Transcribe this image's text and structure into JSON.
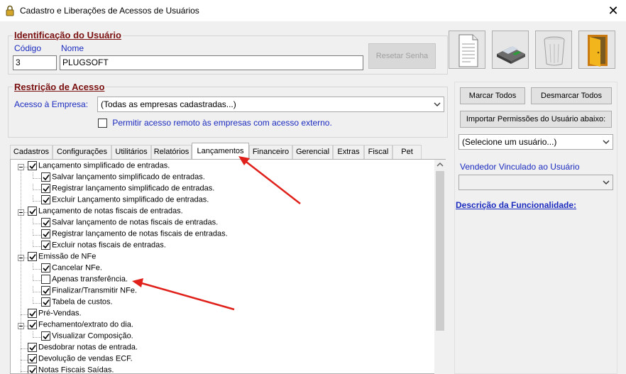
{
  "window": {
    "title": "Cadastro e Liberações de Acessos de Usuários",
    "close_symbol": "✕"
  },
  "identificacao": {
    "section_title": "Identificação do Usuário",
    "codigo_label": "Código",
    "codigo_value": "3",
    "nome_label": "Nome",
    "nome_value": "PLUGSOFT",
    "reset_button": "Resetar Senha"
  },
  "toolbar": {
    "new_icon": "document-icon",
    "save_icon": "floppy-disk-icon",
    "delete_icon": "trash-icon",
    "exit_icon": "exit-door-icon"
  },
  "restricao": {
    "section_title": "Restrição de Acesso",
    "acesso_label": "Acesso à Empresa:",
    "acesso_value": "(Todas as empresas cadastradas...)",
    "remote_checkbox_label": "Permitir acesso remoto às empresas com acesso externo.",
    "remote_checked": false
  },
  "actions": {
    "marcar_todos": "Marcar Todos",
    "desmarcar_todos": "Desmarcar Todos",
    "importar": "Importar Permissões do Usuário abaixo:",
    "user_select_value": "(Selecione um usuário...)"
  },
  "vendedor": {
    "label": "Vendedor Vinculado ao Usuário",
    "value": ""
  },
  "descricao": {
    "label": "Descrição da Funcionalidade:"
  },
  "tabs": [
    {
      "label": "Cadastros",
      "active": false
    },
    {
      "label": "Configurações",
      "active": false
    },
    {
      "label": "Utilitários",
      "active": false
    },
    {
      "label": "Relatórios",
      "active": false
    },
    {
      "label": "Lançamentos",
      "active": true
    },
    {
      "label": "Financeiro",
      "active": false
    },
    {
      "label": "Gerencial",
      "active": false
    },
    {
      "label": "Extras",
      "active": false
    },
    {
      "label": "Fiscal",
      "active": false
    },
    {
      "label": "Pet",
      "active": false
    }
  ],
  "tree": [
    {
      "label": "Lançamento simplificado de entradas.",
      "level": 0,
      "checked": true,
      "expandable": true
    },
    {
      "label": "Salvar lançamento simplificado de entradas.",
      "level": 1,
      "checked": true
    },
    {
      "label": "Registrar lançamento simplificado de entradas.",
      "level": 1,
      "checked": true
    },
    {
      "label": "Excluir Lançamento simplificado de entradas.",
      "level": 1,
      "checked": true
    },
    {
      "label": "Lançamento de notas fiscais de entradas.",
      "level": 0,
      "checked": true,
      "expandable": true
    },
    {
      "label": "Salvar lançamento de notas fiscais de entradas.",
      "level": 1,
      "checked": true
    },
    {
      "label": "Registrar lançamento de notas fiscais de entradas.",
      "level": 1,
      "checked": true
    },
    {
      "label": "Excluir notas fiscais de entradas.",
      "level": 1,
      "checked": true
    },
    {
      "label": "Emissão de NFe",
      "level": 0,
      "checked": true,
      "expandable": true
    },
    {
      "label": "Cancelar NFe.",
      "level": 1,
      "checked": true
    },
    {
      "label": "Apenas transferência.",
      "level": 1,
      "checked": false
    },
    {
      "label": "Finalizar/Transmitir NFe.",
      "level": 1,
      "checked": true
    },
    {
      "label": "Tabela de custos.",
      "level": 1,
      "checked": true
    },
    {
      "label": "Pré-Vendas.",
      "level": 0,
      "checked": true,
      "expandable": false
    },
    {
      "label": "Fechamento/extrato do dia.",
      "level": 0,
      "checked": true,
      "expandable": true
    },
    {
      "label": "Visualizar Composição.",
      "level": 1,
      "checked": true
    },
    {
      "label": "Desdobrar notas de entrada.",
      "level": 0,
      "checked": true,
      "expandable": false
    },
    {
      "label": "Devolução de vendas ECF.",
      "level": 0,
      "checked": true,
      "expandable": false
    },
    {
      "label": "Notas Fiscais Saídas.",
      "level": 0,
      "checked": true,
      "expandable": false
    }
  ],
  "colors": {
    "section_title": "#7a0f0f",
    "label_blue": "#1b2bbf",
    "arrow_red": "#e0201a"
  }
}
